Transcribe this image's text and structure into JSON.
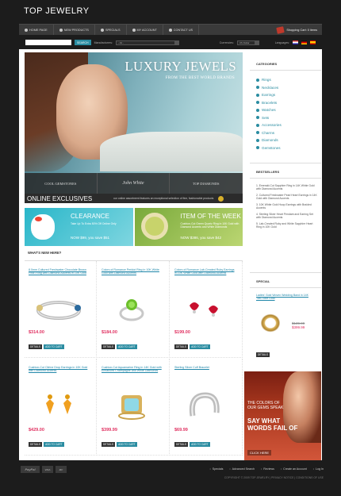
{
  "header": {
    "logo": "TOP JEWELRY",
    "cart": "Shopping Cart: 0 items"
  },
  "nav": [
    "HOME PAGE",
    "NEW PRODUCTS",
    "SPECIALS",
    "MY ACCOUNT",
    "CONTACT US"
  ],
  "search": {
    "button": "SEARCH",
    "manufacturers_label": "Manufacturers:",
    "manufacturers_value": "- All -",
    "currencies_label": "Currencies:",
    "currencies_value": "US Dollar",
    "languages_label": "Languages:"
  },
  "hero": {
    "title": "LUXURY JEWELS",
    "subtitle": "FROM THE BEST WORLD BRANDS",
    "tabs": [
      "COOL GEMSTONES",
      "John White",
      "TOP DIAMONDS"
    ],
    "exclusives_title": "ONLINE EXCLUSIVES",
    "exclusives_text": "our online assortment features an exceptional selection of fine, fashionable products"
  },
  "promos": [
    {
      "title": "CLEARANCE",
      "text": "Take Up To Extra 50% Off Online Only",
      "price": "NOW $99, you save $51"
    },
    {
      "title": "ITEM OF THE WEEK",
      "text": "Cushion-Cut Green Quartz Ring in 10K Gold with Diamond Accents and White Diamonds",
      "price": "NOW $386, you save $42"
    }
  ],
  "whats_new": "WHAT'S NEW HERE?",
  "products": [
    {
      "title": "8.0mm Cultured Freshwater Chocolate Brown Pearl Ring with Diamond Accents in 10K Gold",
      "price": "$314.00",
      "old": ""
    },
    {
      "title": "Colors of Romance Peridot Ring in 10K White Gold with Diamond Accents",
      "price": "$184.00",
      "old": ""
    },
    {
      "title": "Colors of Romance Lab-Created Ruby Earrings in 10K White Gold with Diamond Accents",
      "price": "$199.00",
      "old": ""
    },
    {
      "title": "Cushion-Cut Citrine Drop Earrings in 10K Gold with Diamond Accents",
      "price": "$429.00",
      "old": ""
    },
    {
      "title": "Cushion-Cut Aquamarine Ring in 14K Gold with Enhanced Champagne and White Diamonds",
      "price": "$399.99",
      "old": ""
    },
    {
      "title": "Sterling Silver Cuff Bracelet",
      "price": "$69.99",
      "old": ""
    }
  ],
  "btn_details": "DETAILS",
  "btn_cart": "ADD TO CART",
  "sidebar": {
    "categories_title": "CATEGORIES",
    "categories": [
      "Rings",
      "Necklaces",
      "Earrings",
      "Bracelets",
      "Watches",
      "Sets",
      "Accessories",
      "Charms",
      "Diamonds",
      "Gemstones"
    ],
    "bestsellers_title": "BESTSELLERS",
    "bestsellers": [
      "1. Emerald-Cut Sapphire Ring in 14K White Gold with Diamond Accents",
      "2. Cultured Freshwater Pearl Heart Earrings in 14K Gold with Diamond Accents",
      "3. 10K White Gold Hoop Earrings with Braided Accents",
      "4. Sterling Silver Heart Pendant and Earring Set with Diamond Accents",
      "5. Lab-Created Ruby and White Sapphire Heart Ring in 10K Gold"
    ],
    "special_title": "SPECIAL",
    "special_item": "Ladies' Gold Woven Wedding Band in 14K Two-Tone Gold",
    "special_old": "$139.99",
    "special_new": "$399.99",
    "ad_text": "THE COLORS OF OUR GEMS SPEAK",
    "ad_big": "SAY WHAT WORDS FAIL OF",
    "ad_cta": "CLICK HERE"
  },
  "footer": {
    "links": [
      "Specials",
      "Advanced Search",
      "Reviews",
      "Create an Account",
      "Log In"
    ],
    "copyright": "COPYRIGHT © 2009 TOP JEWELRY  |  PRIVACY NOTICE  |  CONDITIONS OF USE"
  },
  "payments": [
    "PayPal",
    "VISA",
    "MC"
  ]
}
